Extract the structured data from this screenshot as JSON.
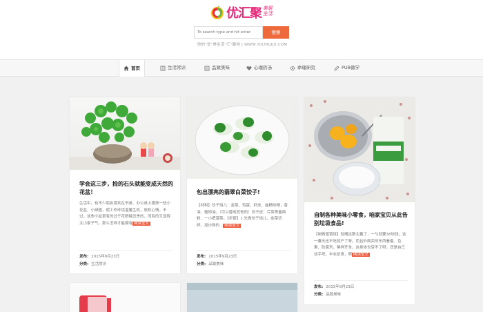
{
  "brand": {
    "logo_text": "优汇聚",
    "slogan": "美居生活",
    "tagline": "你的\"优\"美生活\"汇\"聚地 | WWW.YOUHUIJU.COM",
    "colors": {
      "brand": "#e6287a",
      "accent": "#ee6a3c"
    }
  },
  "search": {
    "placeholder": "To search type and hit enter",
    "button_label": "搜索"
  },
  "nav": {
    "items": [
      {
        "label": "首页",
        "icon": "home-icon",
        "active": true
      },
      {
        "label": "生活常识",
        "icon": "book-icon",
        "active": false
      },
      {
        "label": "品致美味",
        "icon": "list-icon",
        "active": false
      },
      {
        "label": "心理药汤",
        "icon": "heart-icon",
        "active": false
      },
      {
        "label": "命理研究",
        "icon": "gear-icon",
        "active": false
      },
      {
        "label": "PUB微学",
        "icon": "pencil-icon",
        "active": false
      }
    ]
  },
  "posts": [
    {
      "title": "学会这三步，捡的石头就能变成天然的花盆！",
      "excerpt": "生活中，有不少朋友喜欢在书桌、办公桌上摆放一些小花盆、小绿植，使工作环境温馨生机，放松心情。不过，这些小盆景有的过于花哨贼丑贵的，而有的又显得太小家子气，那么怎样才能拥有",
      "read_more": "阅读全文",
      "date_label": "发布:",
      "date": "2015年9月23日",
      "category_label": "分类:",
      "category": "生活常识"
    },
    {
      "title": "包出漂亮的翡翠白菜饺子!",
      "excerpt": "【材料】饺子馅儿：韭菜、鸡蛋、虾皮、盐精味精，香油、植物油。（可以替成其他的）饺子皮：芹菜等量面粉、一小把菠菜。【步骤】1.先做饺子馅儿，韭菜切碎，加炒熟的...",
      "read_more": "阅读全文",
      "date_label": "发布:",
      "date": "2015年9月23日",
      "category_label": "分类:",
      "category": "品致美味"
    },
    {
      "title": "自制各种美味小零食，咱家宝贝从此告别垃圾食品!",
      "excerpt": "【制做驱饿饼】验嘴这斯太蠢了，一勺就要38块钱，这一囊天还不吃就产了呀。而且外面卖的东西看着、色素、防腐剂，稀样齐全，这身体也受不了呀。还是自己动手吧，丰衣足食，啊",
      "read_more": "阅读全文",
      "date_label": "发布:",
      "date": "2015年9月23日",
      "category_label": "分类:",
      "category": "品致美味"
    }
  ]
}
